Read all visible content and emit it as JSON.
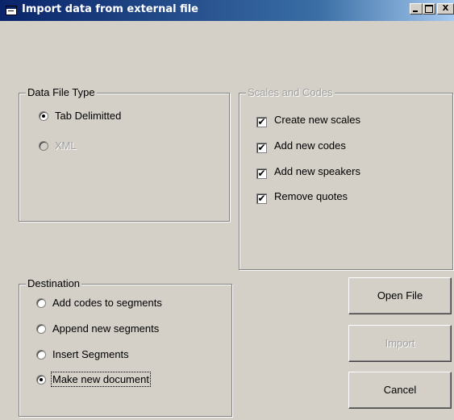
{
  "window": {
    "title": "Import data from external file",
    "close_glyph": "X"
  },
  "data_file_type": {
    "legend": "Data File Type",
    "options": [
      {
        "label": "Tab Delimitted",
        "selected": true,
        "enabled": true
      },
      {
        "label": "XML",
        "selected": false,
        "enabled": false
      }
    ]
  },
  "scales_codes": {
    "legend": "Scales and Codes",
    "enabled": false,
    "options": [
      {
        "label": "Create new scales",
        "checked": true
      },
      {
        "label": "Add new codes",
        "checked": true
      },
      {
        "label": "Add new speakers",
        "checked": true
      },
      {
        "label": "Remove quotes",
        "checked": true
      }
    ],
    "check_glyph": "✔"
  },
  "destination": {
    "legend": "Destination",
    "options": [
      {
        "label": "Add codes to segments",
        "selected": false
      },
      {
        "label": "Append new segments",
        "selected": false
      },
      {
        "label": "Insert Segments",
        "selected": false
      },
      {
        "label": "Make new document",
        "selected": true
      }
    ]
  },
  "buttons": {
    "open_file": "Open File",
    "import": "Import",
    "cancel": "Cancel"
  }
}
